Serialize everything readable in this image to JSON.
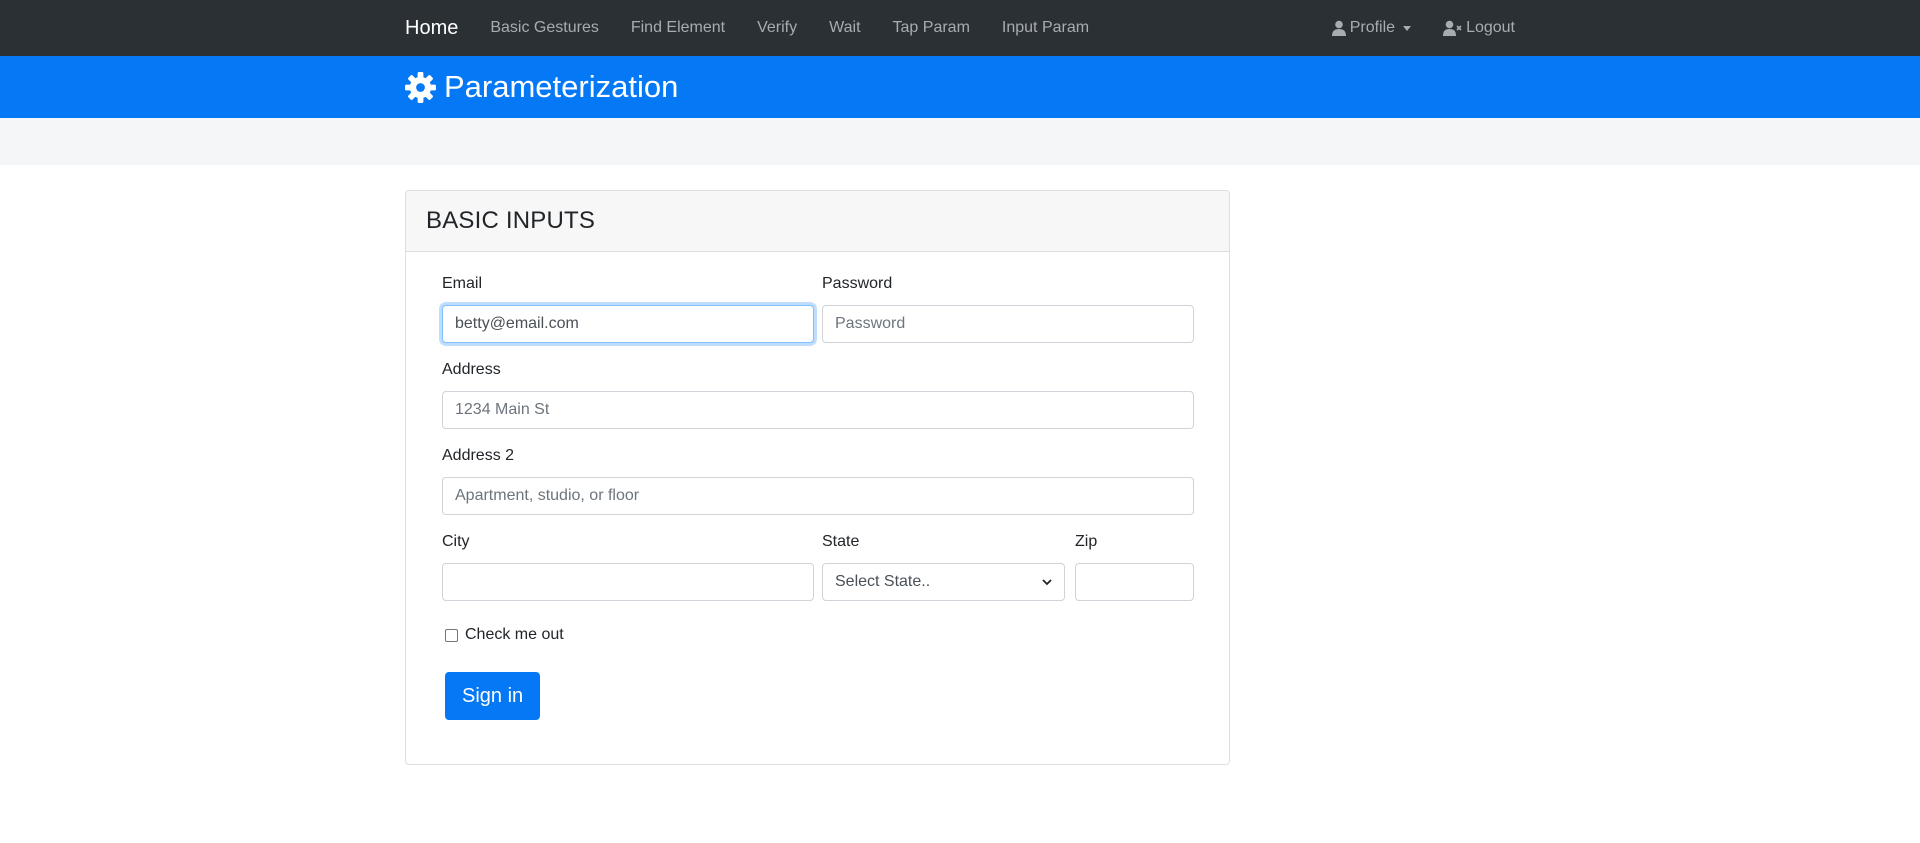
{
  "navbar": {
    "brand": "Home",
    "links": [
      "Basic Gestures",
      "Find Element",
      "Verify",
      "Wait",
      "Tap Param",
      "Input Param"
    ],
    "profile_label": "Profile",
    "logout_label": "Logout"
  },
  "header": {
    "title": "Parameterization",
    "icon": "gear-icon"
  },
  "card": {
    "title": "BASIC INPUTS",
    "email": {
      "label": "Email",
      "value": "betty@email.com"
    },
    "password": {
      "label": "Password",
      "placeholder": "Password"
    },
    "address": {
      "label": "Address",
      "placeholder": "1234 Main St"
    },
    "address2": {
      "label": "Address 2",
      "placeholder": "Apartment, studio, or floor"
    },
    "city": {
      "label": "City",
      "value": ""
    },
    "state": {
      "label": "State",
      "selected": "Select State.."
    },
    "zip": {
      "label": "Zip",
      "value": ""
    },
    "checkbox_label": "Check me out",
    "submit_label": "Sign in"
  },
  "colors": {
    "navbar": "#2b3035",
    "primary": "#0478f5",
    "band": "#f5f6f7"
  }
}
